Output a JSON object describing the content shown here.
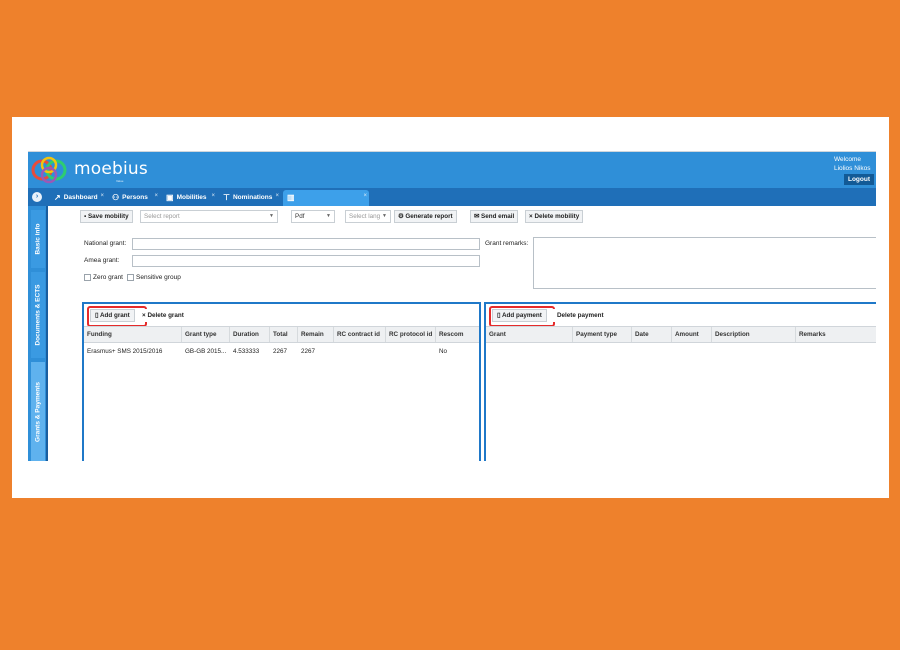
{
  "app": {
    "logo_text": "moebius",
    "logo_sub": "Value",
    "welcome_line1": "Welcome",
    "welcome_line2": "Liolios Nikos",
    "logout_label": "Logout"
  },
  "tabs": [
    {
      "label": "Dashboard",
      "icon": "chart-line-icon"
    },
    {
      "label": "Persons",
      "icon": "users-icon"
    },
    {
      "label": "Mobilities",
      "icon": "briefcase-icon"
    },
    {
      "label": "Nominations",
      "icon": "pin-icon"
    },
    {
      "label": "",
      "icon": "suitcase-icon"
    }
  ],
  "sidebar": {
    "items": [
      {
        "label": "Basic info"
      },
      {
        "label": "Documents & ECTS"
      },
      {
        "label": "Grants & Payments"
      }
    ]
  },
  "toolbar": {
    "save_mobility": "Save mobility",
    "select_report_placeholder": "Select report",
    "format_value": "Pdf",
    "select_lang_placeholder": "Select lang",
    "generate_report": "Generate report",
    "send_email": "Send email",
    "delete_mobility": "Delete mobility"
  },
  "form": {
    "national_grant_label": "National grant:",
    "amea_grant_label": "Amea grant:",
    "zero_grant_label": "Zero grant",
    "sensitive_group_label": "Sensitive group",
    "grant_remarks_label": "Grant remarks:"
  },
  "grants_panel": {
    "add_grant": "Add grant",
    "delete_grant": "Delete grant",
    "columns": [
      "Funding",
      "Grant type",
      "Duration",
      "Total",
      "Remain",
      "RC contract id",
      "RC protocol id",
      "Rescom"
    ],
    "rows": [
      [
        "Erasmus+ SMS 2015/2016",
        "GB-GB 2015...",
        "4.533333",
        "2267",
        "2267",
        "",
        "",
        "No"
      ]
    ]
  },
  "payments_panel": {
    "add_payment": "Add payment",
    "delete_payment": "Delete payment",
    "columns": [
      "Grant",
      "Payment type",
      "Date",
      "Amount",
      "Description",
      "Remarks"
    ],
    "rows": []
  },
  "colors": {
    "background": "#ee812c",
    "header": "#2f8fd8",
    "tabbar": "#1f6fb8",
    "highlight": "#e52b2b"
  }
}
